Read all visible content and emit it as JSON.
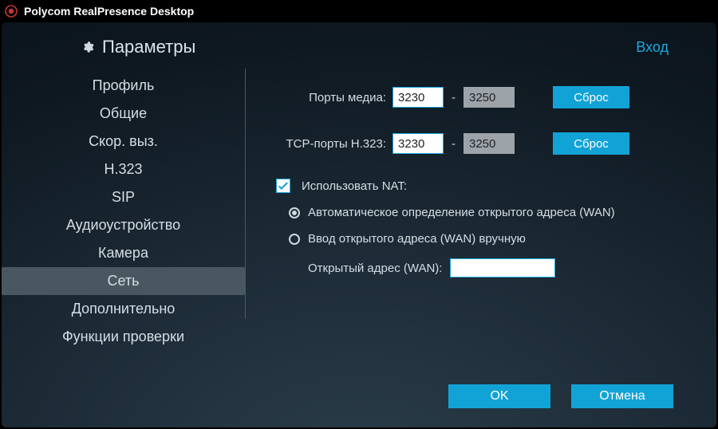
{
  "app_title": "Polycom RealPresence Desktop",
  "header": {
    "title": "Параметры",
    "login": "Вход"
  },
  "sidebar": {
    "items": [
      {
        "label": "Профиль"
      },
      {
        "label": "Общие"
      },
      {
        "label": "Скор. выз."
      },
      {
        "label": "H.323"
      },
      {
        "label": "SIP"
      },
      {
        "label": "Аудиоустройство"
      },
      {
        "label": "Камера"
      },
      {
        "label": "Сеть",
        "active": true
      },
      {
        "label": "Дополнительно"
      },
      {
        "label": "Функции проверки"
      }
    ]
  },
  "content": {
    "media_ports_label": "Порты медиа:",
    "media_ports_from": "3230",
    "media_ports_to": "3250",
    "tcp_ports_label": "TCP-порты H.323:",
    "tcp_ports_from": "3230",
    "tcp_ports_to": "3250",
    "reset_label": "Сброс",
    "dash": "-",
    "use_nat_label": "Использовать NAT:",
    "use_nat_checked": true,
    "radio_auto_label": "Автоматическое определение открытого адреса (WAN)",
    "radio_manual_label": "Ввод открытого адреса (WAN) вручную",
    "radio_selected": "auto",
    "wan_addr_label": "Открытый адрес (WAN):",
    "wan_addr_value": ""
  },
  "footer": {
    "ok": "OK",
    "cancel": "Отмена"
  }
}
